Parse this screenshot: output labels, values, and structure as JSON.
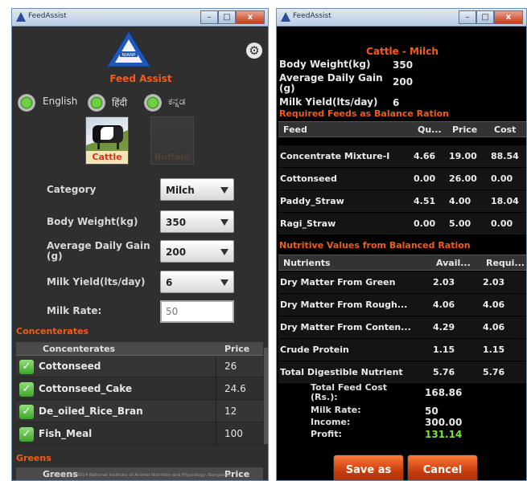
{
  "left_window": {
    "title": "FeedAssist",
    "app_name": "Feed Assist",
    "logo_text": "NIANP",
    "languages": [
      "English",
      "हिंदी",
      "ಕನ್ನಡ"
    ],
    "animals": {
      "cattle": "Cattle",
      "buffalo": "Buffalo"
    },
    "form": {
      "category_label": "Category",
      "category_value": "Milch",
      "body_weight_label": "Body Weight(kg)",
      "body_weight_value": "350",
      "adg_label": "Average Daily Gain (g)",
      "adg_value": "200",
      "milk_yield_label": "Milk Yield(lts/day)",
      "milk_yield_value": "6",
      "milk_rate_label": "Milk Rate:",
      "milk_rate_value": "50"
    },
    "concentrates_section": "Concenterates",
    "concentrates_header": {
      "name": "Concenterates",
      "price": "Price"
    },
    "concentrates": [
      {
        "name": "Cottonseed",
        "price": "26"
      },
      {
        "name": "Cottonseed_Cake",
        "price": "24.6"
      },
      {
        "name": "De_oiled_Rice_Bran",
        "price": "12"
      },
      {
        "name": "Fish_Meal",
        "price": "100"
      }
    ],
    "greens_section": "Greens",
    "greens_header": {
      "name": "Greens",
      "price": "Price"
    },
    "footer": "Copyright © 2014 National Institute of Animal Nutrition and Physiology, Bangalore."
  },
  "right_window": {
    "title": "FeedAssist",
    "heading": "Cattle - Milch",
    "body_weight_label": "Body Weight(kg)",
    "body_weight_value": "350",
    "adg_label": "Average Daily Gain (g)",
    "adg_value": "200",
    "milk_yield_label": "Milk Yield(lts/day)",
    "milk_yield_value": "6",
    "feeds_section": "Required Feeds as Balance Ration",
    "feeds_header": {
      "feed": "Feed",
      "qty": "Qu...",
      "price": "Price",
      "cost": "Cost"
    },
    "feeds": [
      {
        "feed": "Concentrate Mixture-I",
        "qty": "4.66",
        "price": "19.00",
        "cost": "88.54"
      },
      {
        "feed": "Cottonseed",
        "qty": "0.00",
        "price": "26.00",
        "cost": "0.00"
      },
      {
        "feed": "Paddy_Straw",
        "qty": "4.51",
        "price": "4.00",
        "cost": "18.04"
      },
      {
        "feed": "Ragi_Straw",
        "qty": "0.00",
        "price": "5.00",
        "cost": "0.00"
      }
    ],
    "nutritive_section": "Nutritive Values from Balanced Ration",
    "nutrients_header": {
      "nutrient": "Nutrients",
      "avail": "Avail...",
      "requi": "Requi..."
    },
    "nutrients": [
      {
        "nutrient": "Dry Matter From Green",
        "avail": "2.03",
        "requi": "2.03"
      },
      {
        "nutrient": "Dry Matter From Rough...",
        "avail": "4.06",
        "requi": "4.06"
      },
      {
        "nutrient": "Dry Matter From Conten...",
        "avail": "4.29",
        "requi": "4.06"
      },
      {
        "nutrient": "Crude Protein",
        "avail": "1.15",
        "requi": "1.15"
      },
      {
        "nutrient": "Total Digestible Nutrient",
        "avail": "5.76",
        "requi": "5.76"
      }
    ],
    "summary": {
      "total_cost_label": "Total Feed Cost (Rs.):",
      "total_cost_value": "168.86",
      "milk_rate_label": "Milk Rate:",
      "milk_rate_value": "50",
      "income_label": "Income:",
      "income_value": "300.00",
      "profit_label": "Profit:",
      "profit_value": "131.14"
    },
    "save_label": "Save as",
    "cancel_label": "Cancel"
  },
  "window_buttons": {
    "minimize": "–",
    "maximize": "□",
    "close": "x"
  },
  "colors": {
    "accent": "#f35b1a",
    "profit": "#7de23a",
    "check": "#5cc23c"
  }
}
